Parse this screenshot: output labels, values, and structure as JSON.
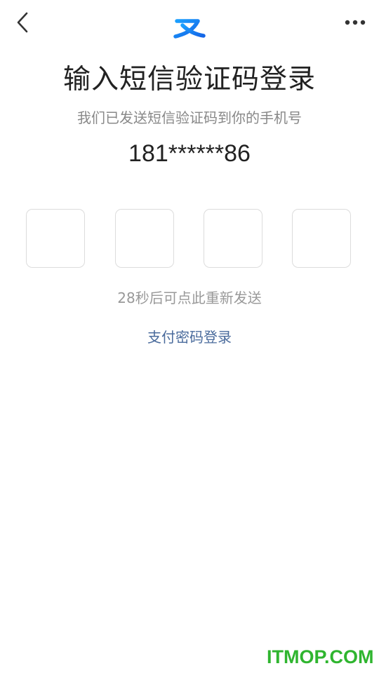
{
  "header": {
    "back_icon": "chevron-left-icon",
    "logo_icon": "alipay-zhi-logo",
    "more_icon": "more-dots-icon",
    "brand_color": "#1677ff"
  },
  "main": {
    "title": "输入短信验证码登录",
    "subtitle": "我们已发送短信验证码到你的手机号",
    "phone": "181******86",
    "code_boxes": [
      "",
      "",
      "",
      ""
    ],
    "resend_text": "28秒后可点此重新发送",
    "password_login_label": "支付密码登录",
    "link_color": "#4a6b9c"
  },
  "watermark": {
    "text": "ITMOP.COM",
    "color": "#2fb52f"
  }
}
